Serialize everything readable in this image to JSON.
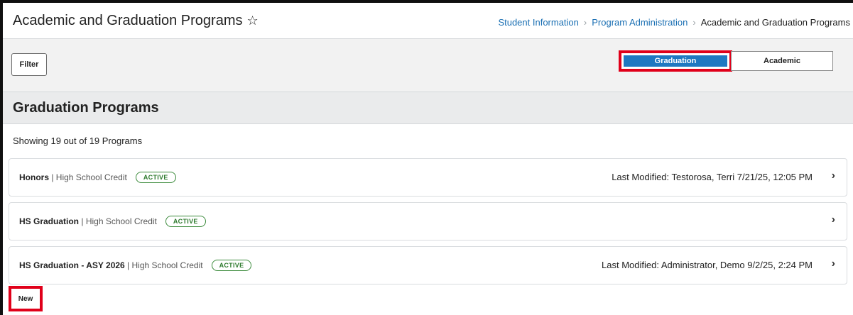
{
  "header": {
    "title": "Academic and Graduation Programs",
    "breadcrumb": [
      "Student Information",
      "Program Administration",
      "Academic and Graduation Programs"
    ]
  },
  "toolbar": {
    "filter_label": "Filter",
    "toggle": {
      "graduation_label": "Graduation",
      "academic_label": "Academic",
      "selected": "Graduation"
    }
  },
  "section": {
    "title": "Graduation Programs"
  },
  "results": {
    "summary": "Showing 19 out of 19 Programs"
  },
  "programs": [
    {
      "name": "Honors",
      "type": "High School Credit",
      "status": "ACTIVE",
      "modified": "Last Modified: Testorosa, Terri 7/21/25, 12:05 PM"
    },
    {
      "name": "HS Graduation",
      "type": "High School Credit",
      "status": "ACTIVE",
      "modified": ""
    },
    {
      "name": "HS Graduation - ASY 2026",
      "type": "High School Credit",
      "status": "ACTIVE",
      "modified": "Last Modified: Administrator, Demo 9/2/25, 2:24 PM"
    }
  ],
  "footer": {
    "new_label": "New"
  },
  "colors": {
    "accent": "#1f78c1",
    "highlight": "#e0001a",
    "active_badge": "#2d7a2d",
    "link": "#1a6fb3"
  }
}
